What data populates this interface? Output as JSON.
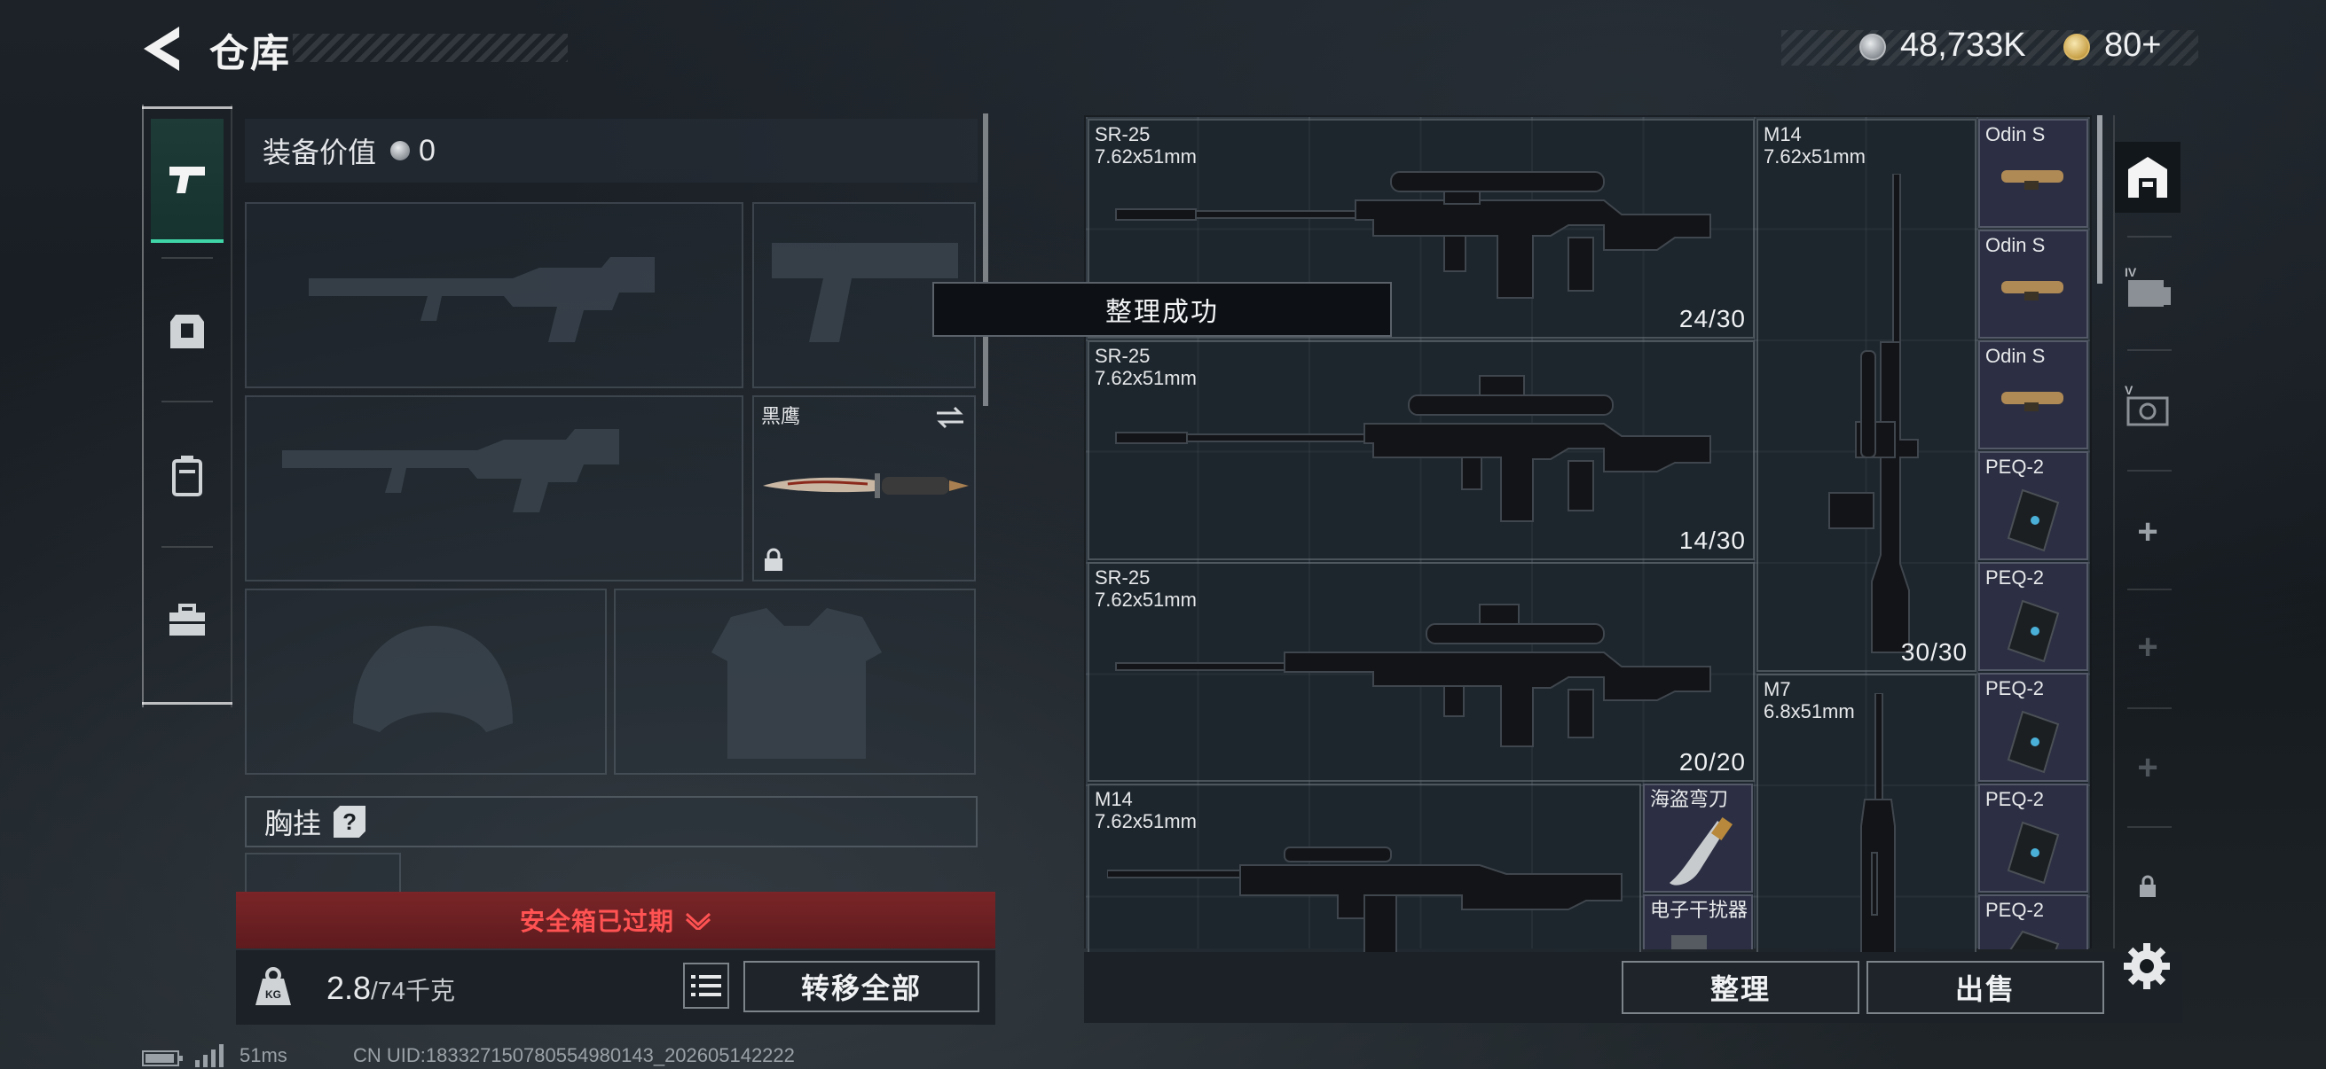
{
  "header": {
    "title": "仓库",
    "silver": "48,733K",
    "gold": "80+"
  },
  "loadout": {
    "equipment_value_label": "装备价值",
    "equipment_value": "0",
    "melee_name": "黑鹰",
    "chest_rig_label": "胸挂",
    "chest_rig_help": "?",
    "safebox_notice": "安全箱已过期",
    "weight_value": "2.8",
    "weight_limit": "/74千克",
    "transfer_all": "转移全部"
  },
  "toast": {
    "message": "整理成功"
  },
  "storage": {
    "items": [
      {
        "name": "SR-25",
        "caliber": "7.62x51mm",
        "ammo": "24/30"
      },
      {
        "name": "SR-25",
        "caliber": "7.62x51mm",
        "ammo": "14/30"
      },
      {
        "name": "SR-25",
        "caliber": "7.62x51mm",
        "ammo": "20/20"
      },
      {
        "name": "M14",
        "caliber": "7.62x51mm",
        "ammo": ""
      },
      {
        "name": "M14",
        "caliber": "7.62x51mm",
        "ammo": "30/30"
      },
      {
        "name": "M7",
        "caliber": "6.8x51mm",
        "ammo": ""
      }
    ],
    "attachments": [
      "Odin S",
      "Odin S",
      "Odin S",
      "PEQ-2",
      "PEQ-2",
      "PEQ-2",
      "PEQ-2",
      "PEQ-2"
    ],
    "misc": [
      "海盗弯刀",
      "电子干扰器"
    ],
    "tidy_button": "整理",
    "sell_button": "出售"
  },
  "status_bar": {
    "ping": "51ms",
    "uid": "CN UID:183327150780554980143_202605142222"
  }
}
